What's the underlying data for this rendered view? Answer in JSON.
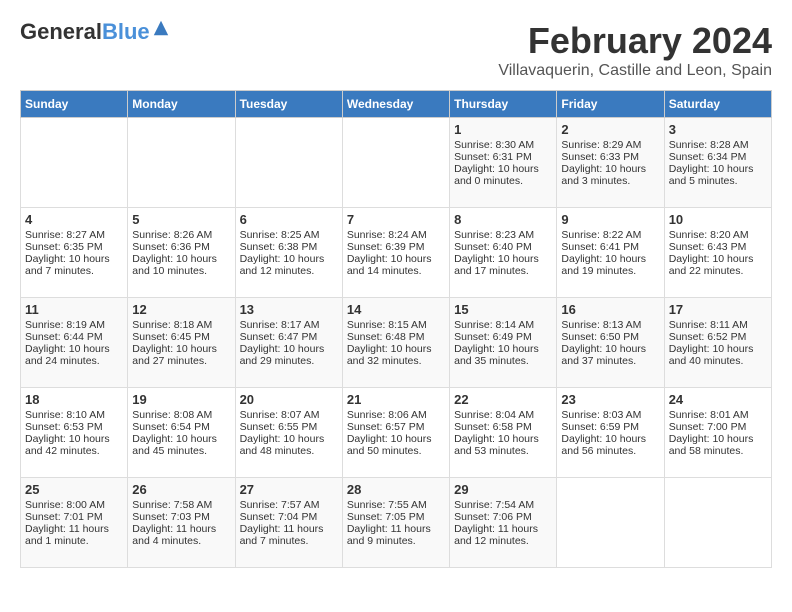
{
  "logo": {
    "line1": "General",
    "line2": "Blue"
  },
  "title": "February 2024",
  "subtitle": "Villavaquerin, Castille and Leon, Spain",
  "header_days": [
    "Sunday",
    "Monday",
    "Tuesday",
    "Wednesday",
    "Thursday",
    "Friday",
    "Saturday"
  ],
  "weeks": [
    [
      {
        "day": "",
        "content": ""
      },
      {
        "day": "",
        "content": ""
      },
      {
        "day": "",
        "content": ""
      },
      {
        "day": "",
        "content": ""
      },
      {
        "day": "1",
        "content": "Sunrise: 8:30 AM\nSunset: 6:31 PM\nDaylight: 10 hours\nand 0 minutes."
      },
      {
        "day": "2",
        "content": "Sunrise: 8:29 AM\nSunset: 6:33 PM\nDaylight: 10 hours\nand 3 minutes."
      },
      {
        "day": "3",
        "content": "Sunrise: 8:28 AM\nSunset: 6:34 PM\nDaylight: 10 hours\nand 5 minutes."
      }
    ],
    [
      {
        "day": "4",
        "content": "Sunrise: 8:27 AM\nSunset: 6:35 PM\nDaylight: 10 hours\nand 7 minutes."
      },
      {
        "day": "5",
        "content": "Sunrise: 8:26 AM\nSunset: 6:36 PM\nDaylight: 10 hours\nand 10 minutes."
      },
      {
        "day": "6",
        "content": "Sunrise: 8:25 AM\nSunset: 6:38 PM\nDaylight: 10 hours\nand 12 minutes."
      },
      {
        "day": "7",
        "content": "Sunrise: 8:24 AM\nSunset: 6:39 PM\nDaylight: 10 hours\nand 14 minutes."
      },
      {
        "day": "8",
        "content": "Sunrise: 8:23 AM\nSunset: 6:40 PM\nDaylight: 10 hours\nand 17 minutes."
      },
      {
        "day": "9",
        "content": "Sunrise: 8:22 AM\nSunset: 6:41 PM\nDaylight: 10 hours\nand 19 minutes."
      },
      {
        "day": "10",
        "content": "Sunrise: 8:20 AM\nSunset: 6:43 PM\nDaylight: 10 hours\nand 22 minutes."
      }
    ],
    [
      {
        "day": "11",
        "content": "Sunrise: 8:19 AM\nSunset: 6:44 PM\nDaylight: 10 hours\nand 24 minutes."
      },
      {
        "day": "12",
        "content": "Sunrise: 8:18 AM\nSunset: 6:45 PM\nDaylight: 10 hours\nand 27 minutes."
      },
      {
        "day": "13",
        "content": "Sunrise: 8:17 AM\nSunset: 6:47 PM\nDaylight: 10 hours\nand 29 minutes."
      },
      {
        "day": "14",
        "content": "Sunrise: 8:15 AM\nSunset: 6:48 PM\nDaylight: 10 hours\nand 32 minutes."
      },
      {
        "day": "15",
        "content": "Sunrise: 8:14 AM\nSunset: 6:49 PM\nDaylight: 10 hours\nand 35 minutes."
      },
      {
        "day": "16",
        "content": "Sunrise: 8:13 AM\nSunset: 6:50 PM\nDaylight: 10 hours\nand 37 minutes."
      },
      {
        "day": "17",
        "content": "Sunrise: 8:11 AM\nSunset: 6:52 PM\nDaylight: 10 hours\nand 40 minutes."
      }
    ],
    [
      {
        "day": "18",
        "content": "Sunrise: 8:10 AM\nSunset: 6:53 PM\nDaylight: 10 hours\nand 42 minutes."
      },
      {
        "day": "19",
        "content": "Sunrise: 8:08 AM\nSunset: 6:54 PM\nDaylight: 10 hours\nand 45 minutes."
      },
      {
        "day": "20",
        "content": "Sunrise: 8:07 AM\nSunset: 6:55 PM\nDaylight: 10 hours\nand 48 minutes."
      },
      {
        "day": "21",
        "content": "Sunrise: 8:06 AM\nSunset: 6:57 PM\nDaylight: 10 hours\nand 50 minutes."
      },
      {
        "day": "22",
        "content": "Sunrise: 8:04 AM\nSunset: 6:58 PM\nDaylight: 10 hours\nand 53 minutes."
      },
      {
        "day": "23",
        "content": "Sunrise: 8:03 AM\nSunset: 6:59 PM\nDaylight: 10 hours\nand 56 minutes."
      },
      {
        "day": "24",
        "content": "Sunrise: 8:01 AM\nSunset: 7:00 PM\nDaylight: 10 hours\nand 58 minutes."
      }
    ],
    [
      {
        "day": "25",
        "content": "Sunrise: 8:00 AM\nSunset: 7:01 PM\nDaylight: 11 hours\nand 1 minute."
      },
      {
        "day": "26",
        "content": "Sunrise: 7:58 AM\nSunset: 7:03 PM\nDaylight: 11 hours\nand 4 minutes."
      },
      {
        "day": "27",
        "content": "Sunrise: 7:57 AM\nSunset: 7:04 PM\nDaylight: 11 hours\nand 7 minutes."
      },
      {
        "day": "28",
        "content": "Sunrise: 7:55 AM\nSunset: 7:05 PM\nDaylight: 11 hours\nand 9 minutes."
      },
      {
        "day": "29",
        "content": "Sunrise: 7:54 AM\nSunset: 7:06 PM\nDaylight: 11 hours\nand 12 minutes."
      },
      {
        "day": "",
        "content": ""
      },
      {
        "day": "",
        "content": ""
      }
    ]
  ]
}
